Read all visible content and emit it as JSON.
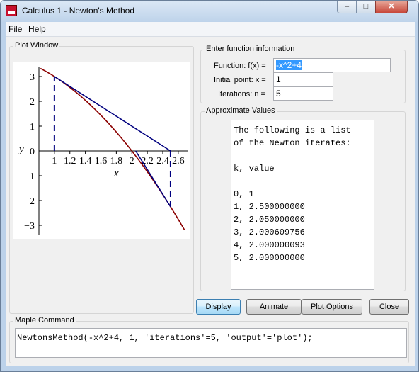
{
  "window": {
    "title": "Calculus 1 - Newton's Method",
    "close_glyph": "✕",
    "min_glyph": "–",
    "max_glyph": "□"
  },
  "menu": {
    "items": [
      "File",
      "Help"
    ]
  },
  "plot": {
    "legend": "Plot Window"
  },
  "chart_data": {
    "type": "line",
    "title": "",
    "xlabel": "x",
    "ylabel": "y",
    "xticks": [
      "1",
      "1.2",
      "1.4",
      "1.6",
      "1.8",
      "2",
      "2.2",
      "2.4",
      "2.6"
    ],
    "xtick_values": [
      1,
      1.2,
      1.4,
      1.6,
      1.8,
      2,
      2.2,
      2.4,
      2.6
    ],
    "yticks": [
      "3",
      "2",
      "1",
      "0",
      "−1",
      "−2",
      "−3"
    ],
    "ytick_values": [
      3,
      2,
      1,
      0,
      -1,
      -2,
      -3
    ],
    "xlim": [
      0.8,
      2.72
    ],
    "ylim": [
      -3.4,
      3.4
    ],
    "curve": {
      "function": "-x^2+4",
      "x_range": [
        0.82,
        2.68
      ],
      "color": "#8b0000"
    },
    "iterates": [
      1,
      2.5
    ],
    "tangent_color": "#00007f",
    "drop_line_color": "#00007f"
  },
  "function_info": {
    "legend": "Enter function information",
    "function_label": "Function:  f(x) =",
    "function_value": "-x^2+4",
    "initial_label": "Initial point:  x =",
    "initial_value": "1",
    "iterations_label": "Iterations:  n =",
    "iterations_value": "5"
  },
  "approx": {
    "legend": "Approximate Values",
    "lines": [
      "The following is a list",
      "of the Newton iterates:",
      "",
      "k, value",
      "",
      "0, 1",
      "1, 2.500000000",
      "2, 2.050000000",
      "3, 2.000609756",
      "4, 2.000000093",
      "5, 2.000000000"
    ]
  },
  "buttons": {
    "display": "Display",
    "animate": "Animate",
    "plot_options": "Plot Options",
    "close": "Close"
  },
  "command": {
    "legend": "Maple Command",
    "text": "NewtonsMethod(-x^2+4, 1, 'iterations'=5, 'output'='plot');"
  }
}
